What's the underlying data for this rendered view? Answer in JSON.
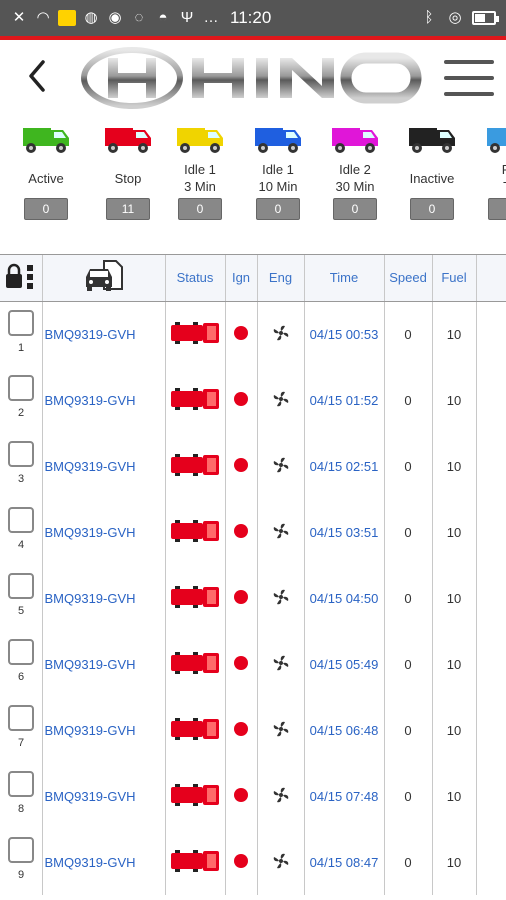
{
  "status_bar": {
    "time": "11:20",
    "left_icons": [
      "x-icon",
      "wifi-icon",
      "notification-box-icon",
      "globe-icon",
      "dot-icon",
      "whatsapp-icon",
      "cat-icon",
      "usb-icon",
      "more-icon"
    ],
    "right_icons": [
      "bluetooth-icon",
      "location-icon",
      "battery-icon"
    ]
  },
  "header": {
    "brand": "HINO",
    "accent_color": "#e0171b"
  },
  "filters": [
    {
      "label": "Active",
      "count": "0",
      "color": "#3fb61f"
    },
    {
      "label": "Stop",
      "count": "11",
      "color": "#e5001c"
    },
    {
      "label": "Idle 1\n3 Min",
      "count": "0",
      "color": "#f0d400"
    },
    {
      "label": "Idle 1\n10 Min",
      "count": "0",
      "color": "#1f5fe0"
    },
    {
      "label": "Idle 2\n30 Min",
      "count": "0",
      "color": "#e016d8"
    },
    {
      "label": "Inactive",
      "count": "0",
      "color": "#222222"
    },
    {
      "label": "Re\nTo",
      "count": "",
      "color": "#3a9be0"
    }
  ],
  "table": {
    "headers": {
      "status": "Status",
      "ign": "Ign",
      "eng": "Eng",
      "time": "Time",
      "speed": "Speed",
      "fuel": "Fuel"
    },
    "rows": [
      {
        "num": "1",
        "plate": "BMQ9319-GVH",
        "time": "04/15 00:53",
        "speed": "0",
        "fuel": "10"
      },
      {
        "num": "2",
        "plate": "BMQ9319-GVH",
        "time": "04/15 01:52",
        "speed": "0",
        "fuel": "10"
      },
      {
        "num": "3",
        "plate": "BMQ9319-GVH",
        "time": "04/15 02:51",
        "speed": "0",
        "fuel": "10"
      },
      {
        "num": "4",
        "plate": "BMQ9319-GVH",
        "time": "04/15 03:51",
        "speed": "0",
        "fuel": "10"
      },
      {
        "num": "5",
        "plate": "BMQ9319-GVH",
        "time": "04/15 04:50",
        "speed": "0",
        "fuel": "10"
      },
      {
        "num": "6",
        "plate": "BMQ9319-GVH",
        "time": "04/15 05:49",
        "speed": "0",
        "fuel": "10"
      },
      {
        "num": "7",
        "plate": "BMQ9319-GVH",
        "time": "04/15 06:48",
        "speed": "0",
        "fuel": "10"
      },
      {
        "num": "8",
        "plate": "BMQ9319-GVH",
        "time": "04/15 07:48",
        "speed": "0",
        "fuel": "10"
      },
      {
        "num": "9",
        "plate": "BMQ9319-GVH",
        "time": "04/15 08:47",
        "speed": "0",
        "fuel": "10"
      }
    ]
  }
}
